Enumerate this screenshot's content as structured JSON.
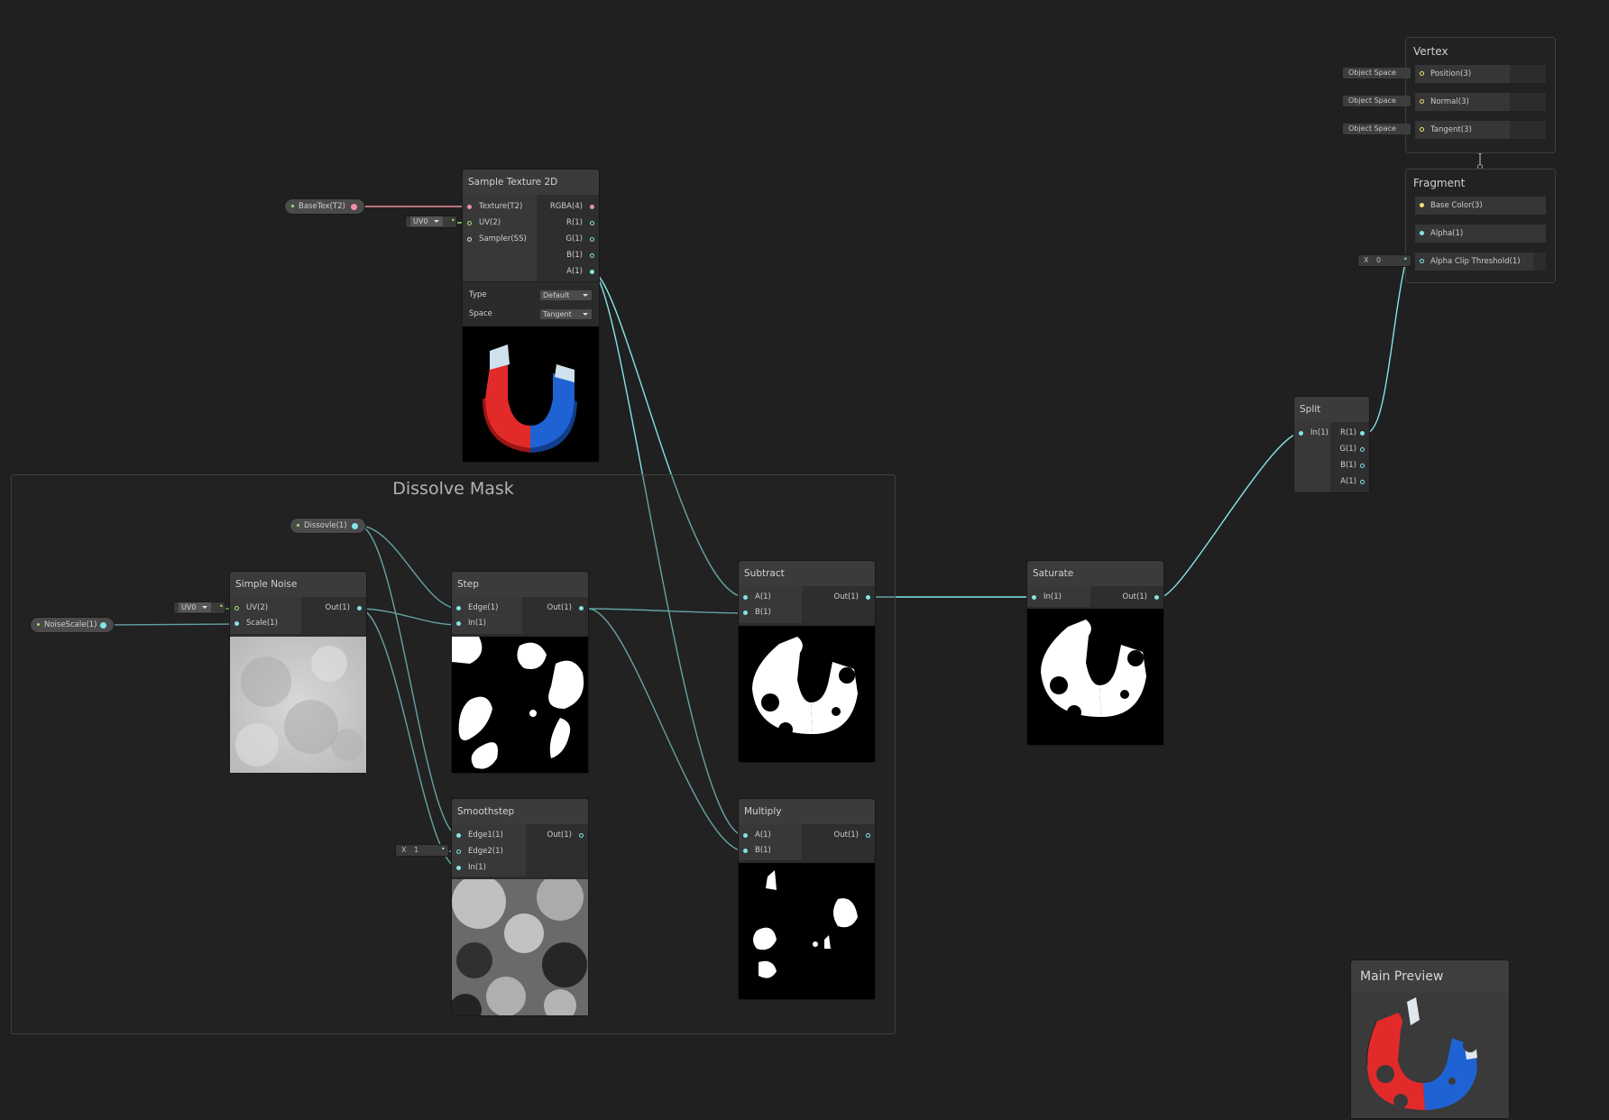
{
  "colors": {
    "background": "#202020",
    "wire_float": "#84e4e7",
    "wire_texture": "#f08fa4",
    "wire_uv": "#9de86a",
    "wire_color": "#f0e070"
  },
  "group": {
    "title": "Dissolve Mask"
  },
  "properties": {
    "basetex": "BaseTex(T2)",
    "dissolve": "Dissovle(1)",
    "noisescale": "NoiseScale(1)"
  },
  "sample_texture": {
    "title": "Sample Texture 2D",
    "inputs": [
      "Texture(T2)",
      "UV(2)",
      "Sampler(SS)"
    ],
    "outputs": [
      "RGBA(4)",
      "R(1)",
      "G(1)",
      "B(1)",
      "A(1)"
    ],
    "uv_value": "UV0",
    "type_label": "Type",
    "type_value": "Default",
    "space_label": "Space",
    "space_value": "Tangent"
  },
  "simple_noise": {
    "title": "Simple Noise",
    "inputs": [
      "UV(2)",
      "Scale(1)"
    ],
    "output": "Out(1)",
    "uv_value": "UV0"
  },
  "step": {
    "title": "Step",
    "inputs": [
      "Edge(1)",
      "In(1)"
    ],
    "output": "Out(1)"
  },
  "smoothstep": {
    "title": "Smoothstep",
    "inputs": [
      "Edge1(1)",
      "Edge2(1)",
      "In(1)"
    ],
    "output": "Out(1)",
    "edge2_axis": "X",
    "edge2_value": "1"
  },
  "subtract": {
    "title": "Subtract",
    "inputs": [
      "A(1)",
      "B(1)"
    ],
    "output": "Out(1)"
  },
  "multiply": {
    "title": "Multiply",
    "inputs": [
      "A(1)",
      "B(1)"
    ],
    "output": "Out(1)"
  },
  "saturate": {
    "title": "Saturate",
    "input": "In(1)",
    "output": "Out(1)"
  },
  "split": {
    "title": "Split",
    "input": "In(1)",
    "outputs": [
      "R(1)",
      "G(1)",
      "B(1)",
      "A(1)"
    ]
  },
  "vertex": {
    "title": "Vertex",
    "rows": [
      "Position(3)",
      "Normal(3)",
      "Tangent(3)"
    ],
    "space": "Object Space"
  },
  "fragment": {
    "title": "Fragment",
    "rows": [
      "Base Color(3)",
      "Alpha(1)",
      "Alpha Clip Threshold(1)"
    ],
    "clip_axis": "X",
    "clip_value": "0"
  },
  "main_preview": {
    "title": "Main Preview"
  }
}
